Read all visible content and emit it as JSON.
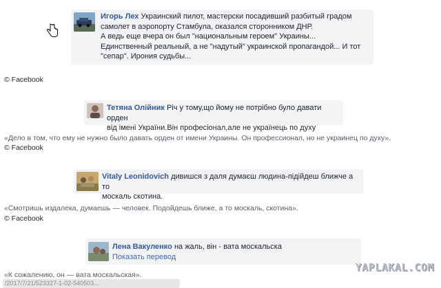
{
  "comments": [
    {
      "author": "Игорь Лех",
      "lines": [
        "Украинский пилот, мастерски посадивший разбитый градом",
        "самолет в аэропорту Стамбула, оказался сторонником ДНР.",
        "А ведь еще вчера он был \"национальным героем\" Украины...",
        "Единственный реальный, а не \"надутый\" украинской пропагандой... И тот",
        "\"сепар\". Ирония судьбы..."
      ]
    },
    {
      "author": "Тетяна Олійник",
      "lines": [
        "Річ у тому,що йому не потрібно було давати орден",
        "від імені України.Він професіонал,але не українець по духу"
      ]
    },
    {
      "author": "Vitaly Leonidovich",
      "lines": [
        "дивишся з даля думаєш людина-підійдеш ближче а то",
        "москаль скотина."
      ]
    },
    {
      "author": "Лена Вакуленко",
      "lines": [
        "на жаль, він - вата москальска"
      ],
      "action": "Показать перевод"
    }
  ],
  "credits": [
    "© Facebook",
    "© Facebook",
    "© Facebook"
  ],
  "quotes": [
    "«Дело в том, что ему не нужно было давать орден от имени Украины. Он профессионал, но не украинец по духу».",
    "«Смотришь издалека, думаешь — человек. Подойдешь ближе, а то москаль, скотина».",
    "«К сожалению, он — вата москальская»."
  ],
  "watermark": "YAPLAKAL.COM",
  "url_fragment": "/2017/7/21/523327-1-02-540503..."
}
